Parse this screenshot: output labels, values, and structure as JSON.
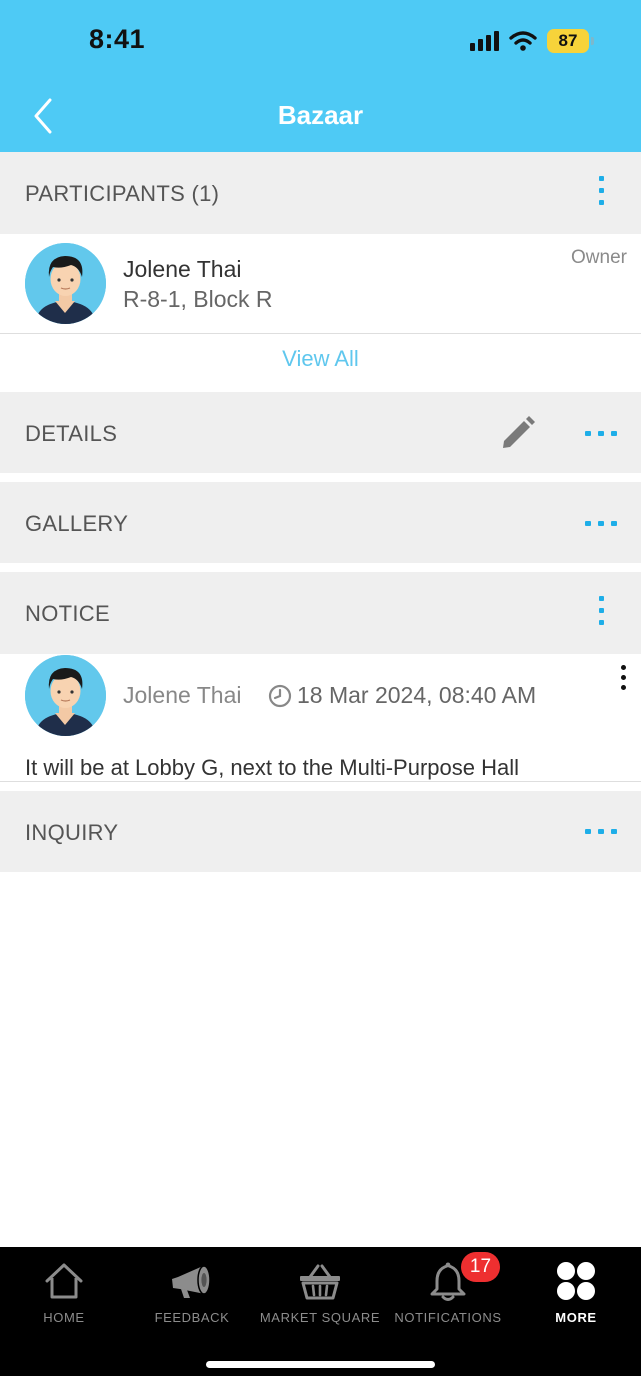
{
  "status_bar": {
    "time": "8:41",
    "battery": "87"
  },
  "header": {
    "title": "Bazaar"
  },
  "participants": {
    "title": "PARTICIPANTS (1)",
    "items": [
      {
        "name": "Jolene Thai",
        "unit": "R-8-1, Block R",
        "role": "Owner"
      }
    ],
    "view_all": "View All"
  },
  "details": {
    "title": "DETAILS"
  },
  "gallery": {
    "title": "GALLERY"
  },
  "notice": {
    "title": "NOTICE",
    "items": [
      {
        "author": "Jolene Thai",
        "timestamp": "18 Mar 2024, 08:40 AM",
        "body": "It will be at Lobby G, next to the Multi-Purpose Hall"
      }
    ]
  },
  "inquiry": {
    "title": "INQUIRY"
  },
  "tabbar": {
    "items": [
      {
        "label": "HOME",
        "icon": "home-icon"
      },
      {
        "label": "FEEDBACK",
        "icon": "megaphone-icon"
      },
      {
        "label": "MARKET SQUARE",
        "icon": "basket-icon"
      },
      {
        "label": "NOTIFICATIONS",
        "icon": "bell-icon",
        "badge": "17"
      },
      {
        "label": "MORE",
        "icon": "more-grid-icon",
        "active": true
      }
    ]
  },
  "colors": {
    "header": "#4ecaf5",
    "accent": "#1eaee8",
    "section_bg": "#efefef",
    "badge": "#ee2f30",
    "tabbar": "#000000"
  }
}
